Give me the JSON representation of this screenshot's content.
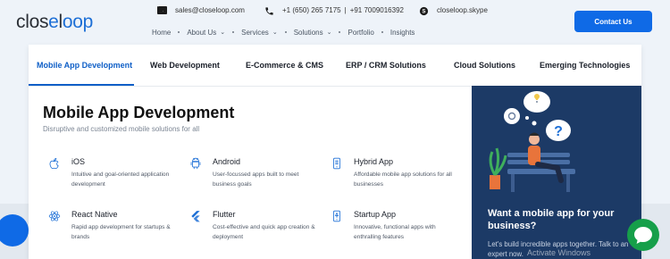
{
  "logo": {
    "left": "clos",
    "o": "e",
    "mid": "l",
    "loop": "oop"
  },
  "contact": {
    "email": "sales@closeloop.com",
    "phone_us": "+1 (650) 265 7175",
    "divider": "|",
    "phone_in": "+91 7009016392",
    "skype": "closeloop.skype"
  },
  "nav": {
    "items": [
      {
        "label": "Home",
        "has_dropdown": false
      },
      {
        "label": "About Us",
        "has_dropdown": true
      },
      {
        "label": "Services",
        "has_dropdown": true
      },
      {
        "label": "Solutions",
        "has_dropdown": true
      },
      {
        "label": "Portfolio",
        "has_dropdown": false
      },
      {
        "label": "Insights",
        "has_dropdown": false
      }
    ]
  },
  "contact_button": "Contact Us",
  "tabs": [
    "Mobile App Development",
    "Web Development",
    "E-Commerce & CMS",
    "ERP / CRM Solutions",
    "Cloud Solutions",
    "Emerging Technologies"
  ],
  "active_tab": "Mobile App Development",
  "section": {
    "title": "Mobile App Development",
    "subtitle": "Disruptive and customized mobile solutions for all"
  },
  "services": [
    {
      "name": "iOS",
      "desc": "Intuitive and goal-oriented application development",
      "icon": "apple-icon"
    },
    {
      "name": "Android",
      "desc": "User-focussed apps built to meet business goals",
      "icon": "android-icon"
    },
    {
      "name": "Hybrid App",
      "desc": "Affordable mobile app solutions for all businesses",
      "icon": "hybrid-app-icon"
    },
    {
      "name": "React Native",
      "desc": "Rapid app development for startups & brands",
      "icon": "react-icon"
    },
    {
      "name": "Flutter",
      "desc": "Cost-effective and quick app creation & deployment",
      "icon": "flutter-icon"
    },
    {
      "name": "Startup App",
      "desc": "Innovative, functional apps with enthralling features",
      "icon": "startup-app-icon"
    }
  ],
  "promo": {
    "title": "Want a mobile app for your business?",
    "text": "Let's build incredible apps together. Talk to an expert now."
  },
  "watermark": "Activate Windows",
  "colors": {
    "accent": "#0f6ae6",
    "promo_bg": "#1c3a66",
    "chat": "#169f4a"
  }
}
